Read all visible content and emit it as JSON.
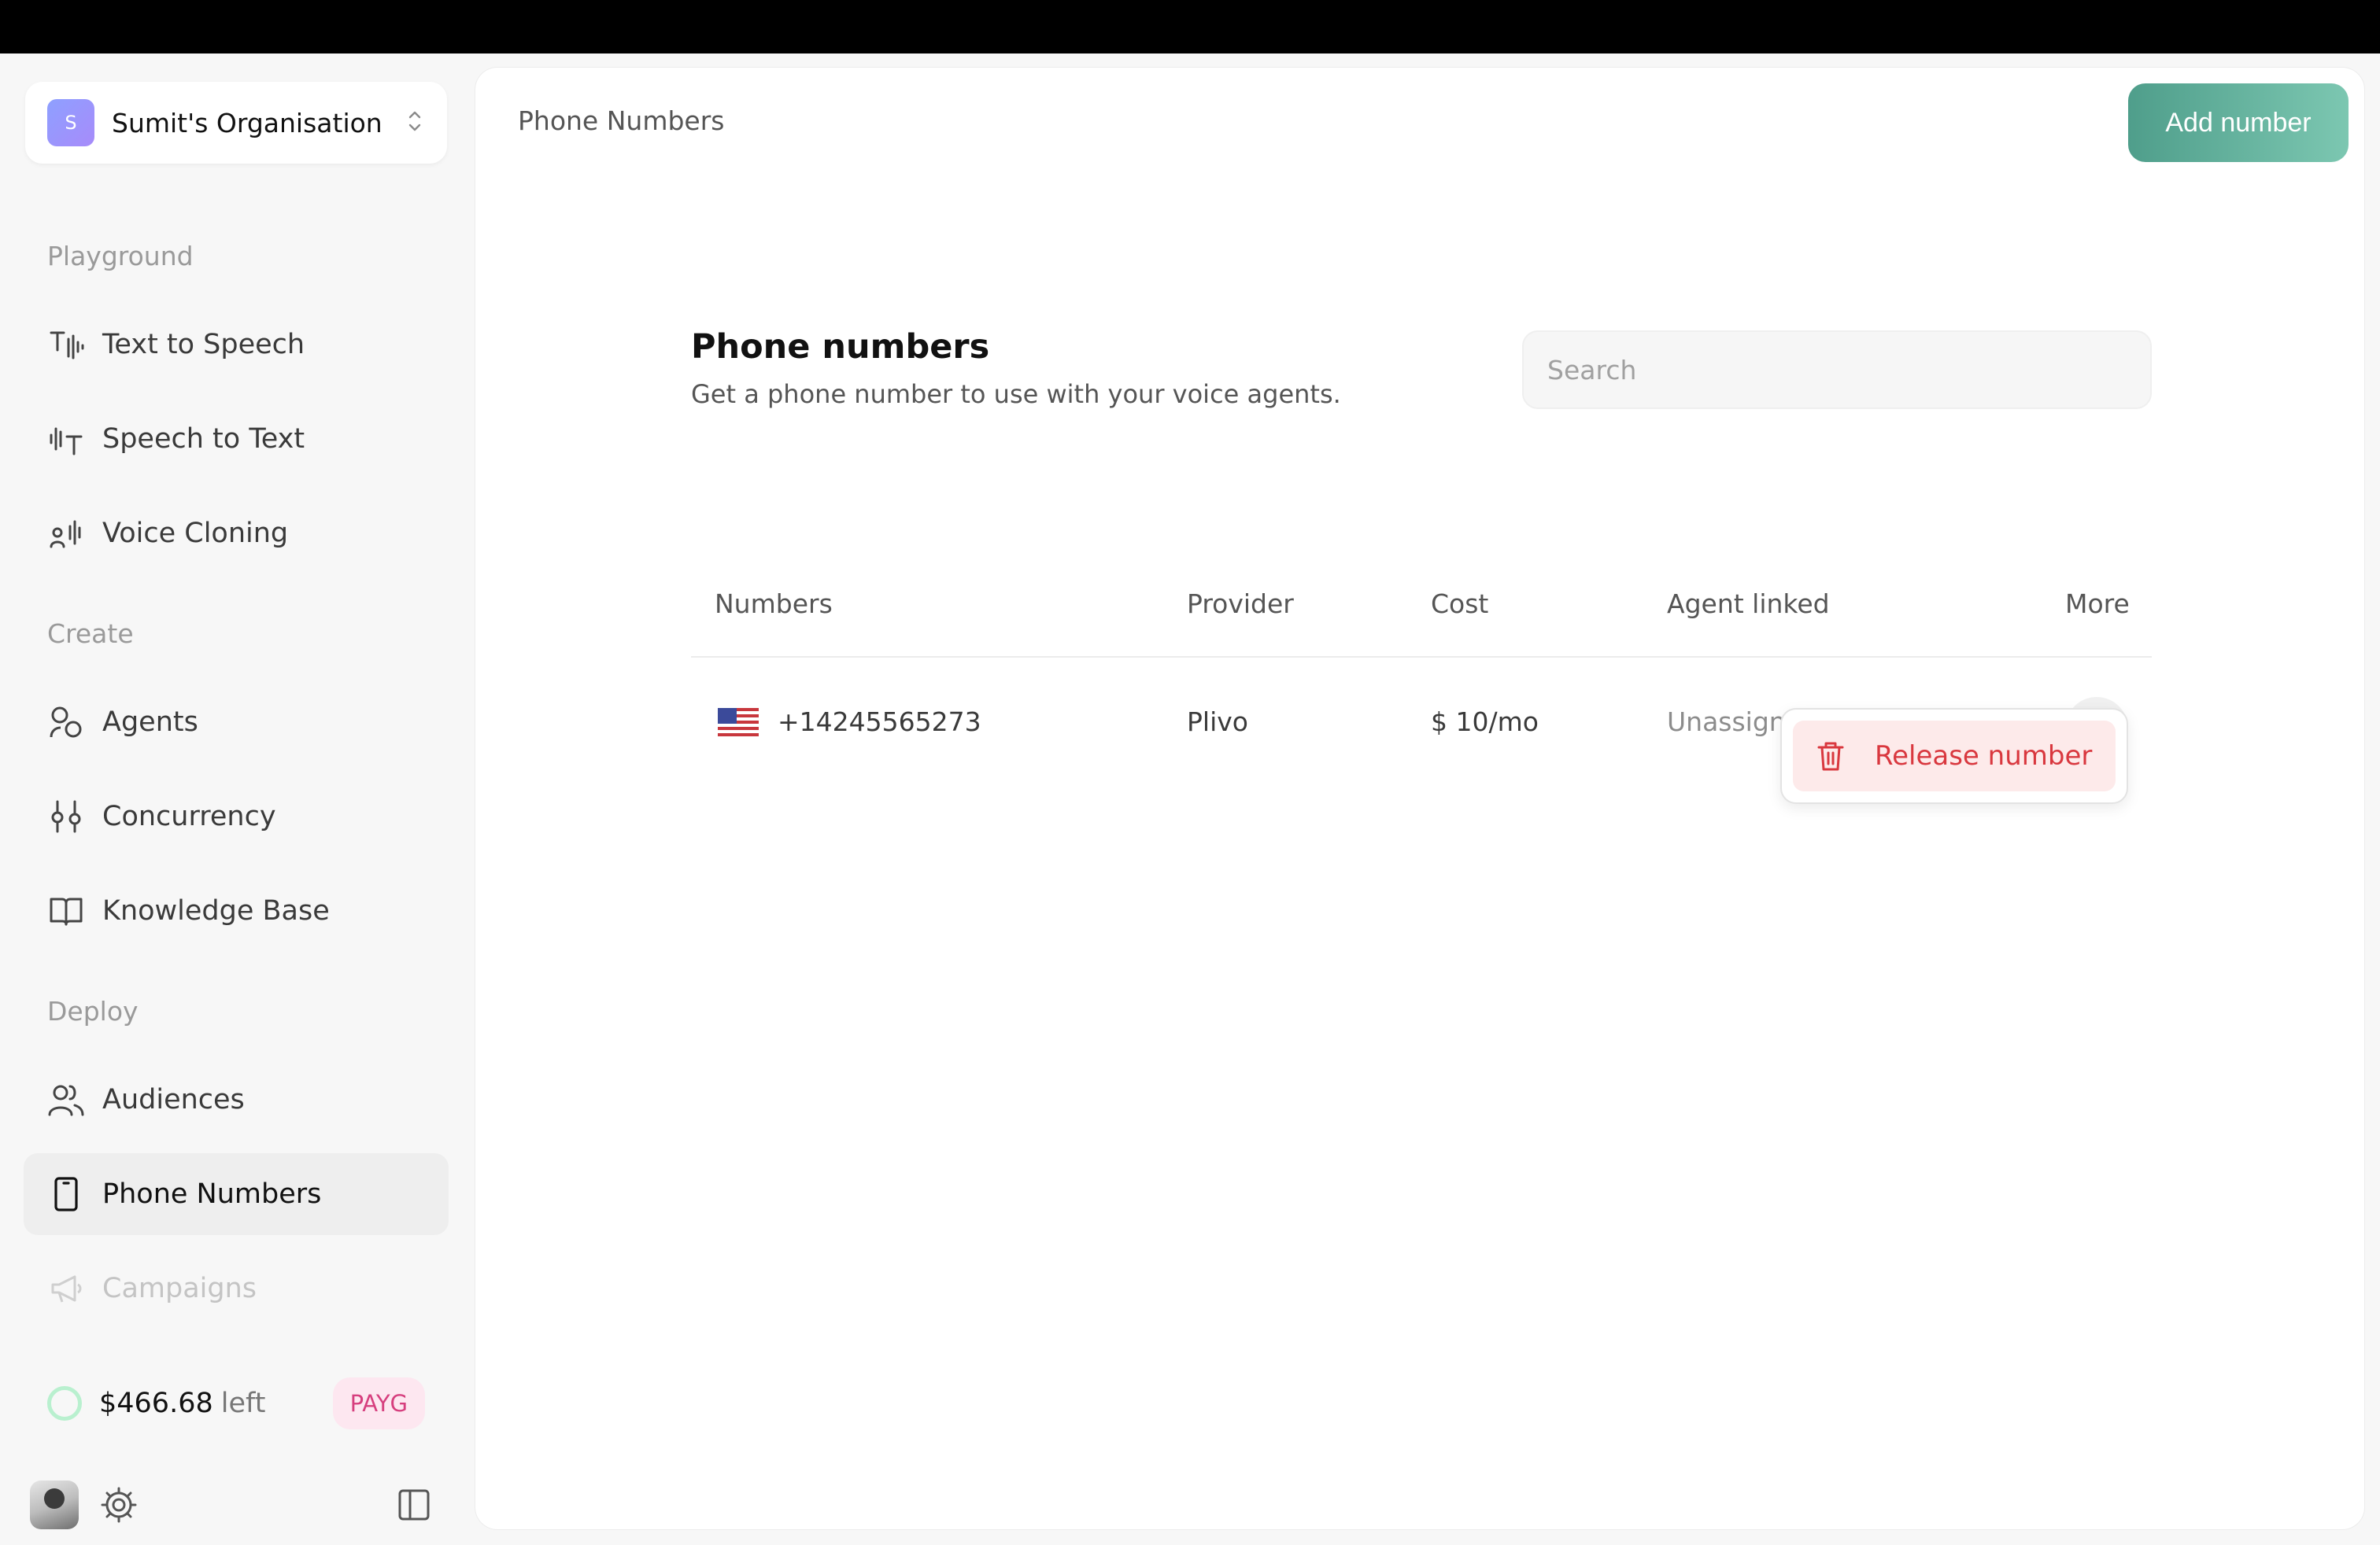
{
  "organisation": {
    "avatar_letter": "S",
    "name": "Sumit's Organisation"
  },
  "sidebar": {
    "sections": [
      {
        "label": "Playground",
        "items": [
          {
            "label": "Text to Speech",
            "icon": "text-to-speech-icon"
          },
          {
            "label": "Speech to Text",
            "icon": "speech-to-text-icon"
          },
          {
            "label": "Voice Cloning",
            "icon": "voice-cloning-icon"
          }
        ]
      },
      {
        "label": "Create",
        "items": [
          {
            "label": "Agents",
            "icon": "agents-icon"
          },
          {
            "label": "Concurrency",
            "icon": "concurrency-icon"
          },
          {
            "label": "Knowledge Base",
            "icon": "book-icon"
          }
        ]
      },
      {
        "label": "Deploy",
        "items": [
          {
            "label": "Audiences",
            "icon": "users-icon"
          },
          {
            "label": "Phone Numbers",
            "icon": "phone-icon",
            "active": true
          },
          {
            "label": "Campaigns",
            "icon": "megaphone-icon"
          }
        ]
      }
    ],
    "credits": {
      "amount": "$466.68",
      "suffix": "left",
      "plan_badge": "PAYG"
    }
  },
  "header": {
    "breadcrumb": "Phone Numbers",
    "add_button": "Add number"
  },
  "page": {
    "title": "Phone numbers",
    "subtitle": "Get a phone number to use with your voice agents.",
    "search_placeholder": "Search"
  },
  "table": {
    "columns": [
      "Numbers",
      "Provider",
      "Cost",
      "Agent linked",
      "More"
    ],
    "rows": [
      {
        "country_flag": "us-flag-icon",
        "number": "+14245565273",
        "provider": "Plivo",
        "cost": "$ 10/mo",
        "agent": "Unassigned"
      }
    ]
  },
  "row_menu": {
    "release_label": "Release number"
  },
  "colors": {
    "accent": "#5ba896",
    "danger": "#d9383f",
    "payg": "#d63f7e"
  }
}
